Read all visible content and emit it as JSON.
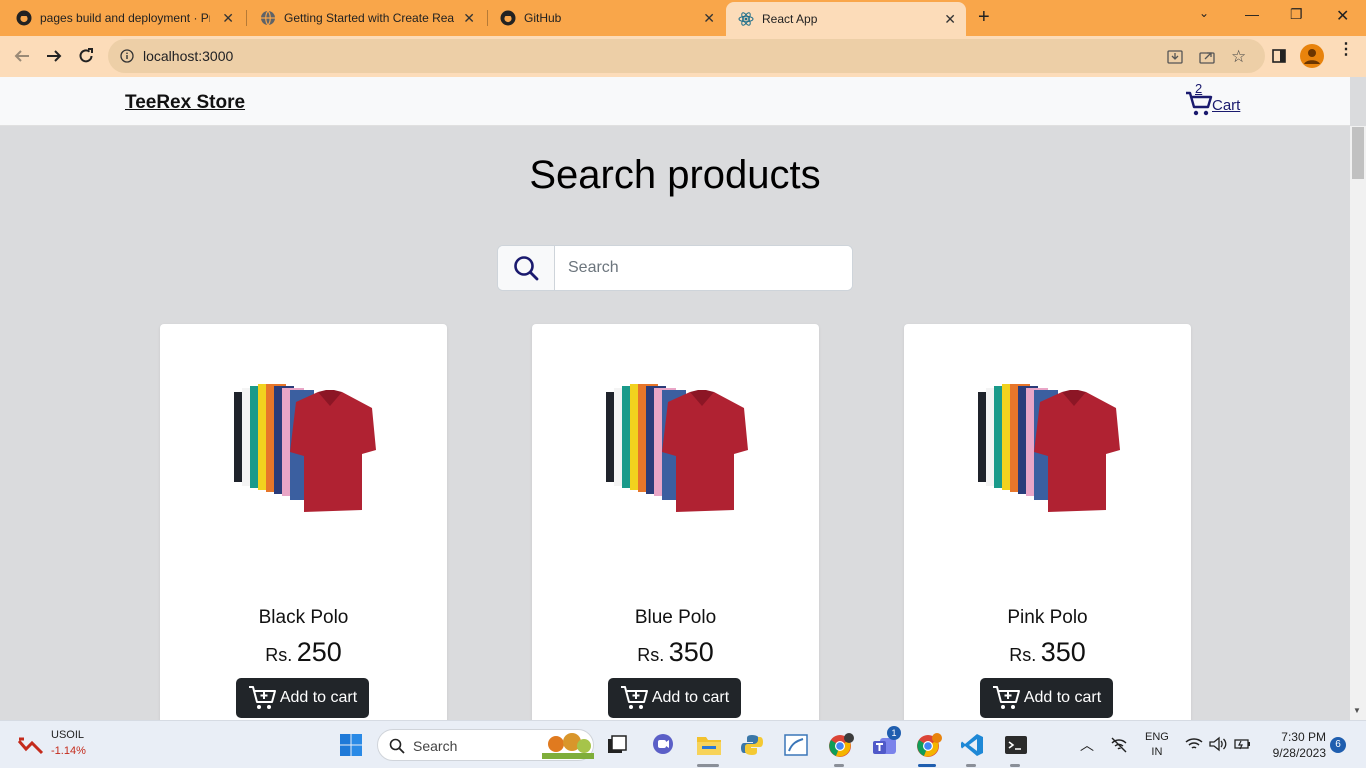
{
  "browser": {
    "tabs": [
      {
        "title": "pages build and deployment · Pr",
        "icon": "github-icon"
      },
      {
        "title": "Getting Started with Create Reac",
        "icon": "globe-icon"
      },
      {
        "title": "GitHub",
        "icon": "github-icon"
      },
      {
        "title": "React App",
        "icon": "react-icon",
        "active": true
      }
    ],
    "url": "localhost:3000"
  },
  "app": {
    "brand": "TeeRex Store",
    "cart_count": "2",
    "cart_label": "Cart",
    "heading": "Search products",
    "search_placeholder": "Search",
    "search_value": "",
    "currency": "Rs.",
    "add_to_cart_label": "Add to cart",
    "products": [
      {
        "name": "Black Polo",
        "price": "250"
      },
      {
        "name": "Blue Polo",
        "price": "350"
      },
      {
        "name": "Pink Polo",
        "price": "350"
      }
    ]
  },
  "taskbar": {
    "stock_name": "USOIL",
    "stock_change": "-1.14%",
    "search_label": "Search",
    "teams_badge": "1",
    "lang": "ENG",
    "region": "IN",
    "time": "7:30 PM",
    "date": "9/28/2023",
    "notifications": "6"
  },
  "colors": {
    "tabbar": "#f9a64a",
    "toolbar": "#fcdcb9",
    "page_bg": "#dadbdd",
    "button_dark": "#212529",
    "link_blue": "#1a1a6e"
  }
}
